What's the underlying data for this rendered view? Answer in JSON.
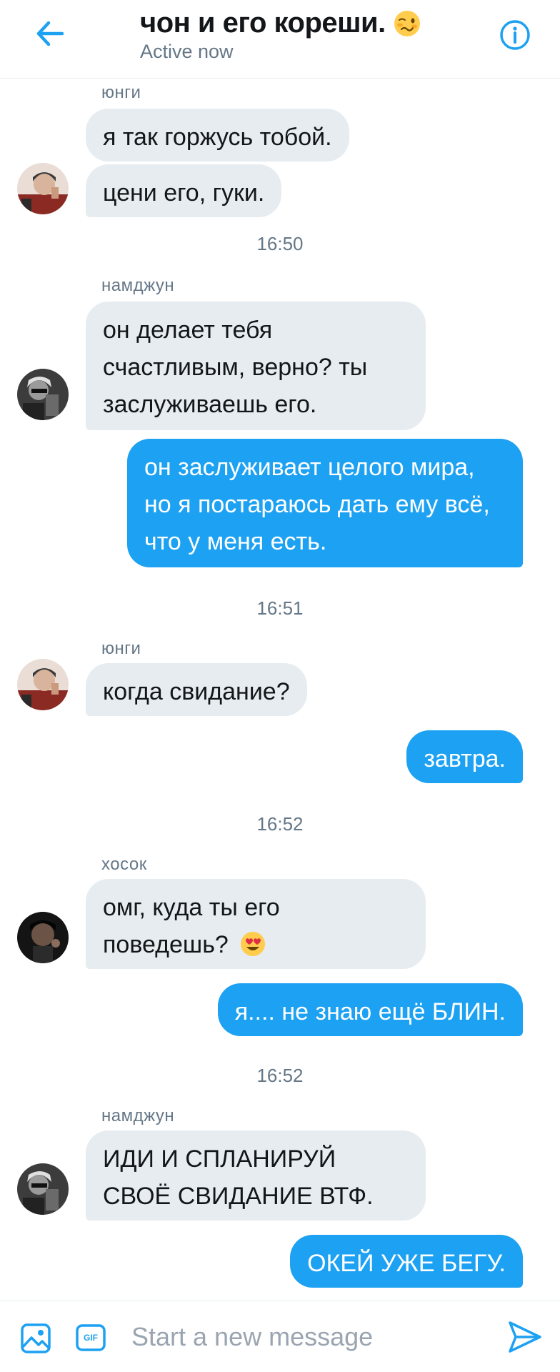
{
  "header": {
    "title": "чон и его кореши.",
    "title_emoji": "woozy-face-emoji",
    "subtitle": "Active now",
    "back_icon": "arrow-left-icon",
    "info_icon": "info-icon"
  },
  "colors": {
    "accent": "#1da1f2",
    "incoming_bubble": "#e6ecf0",
    "secondary_text": "#657786"
  },
  "messages": [
    {
      "sender": "юнги"
    },
    {
      "text": "я так горжусь тобой."
    },
    {
      "text": "цени его, гуки."
    },
    {
      "time": "16:50"
    },
    {
      "sender": "намджун"
    },
    {
      "text": "он делает тебя счастливым, верно? ты заслуживаешь его."
    },
    {
      "text": "он заслуживает целого мира, но я постараюсь дать ему всё, что у меня есть."
    },
    {
      "time": "16:51"
    },
    {
      "sender": "юнги"
    },
    {
      "text": "когда свидание?"
    },
    {
      "text": "завтра."
    },
    {
      "time": "16:52"
    },
    {
      "sender": "хосок"
    },
    {
      "text": "омг, куда ты его поведешь?",
      "emoji": "heart-eyes-emoji"
    },
    {
      "text": "я.... не знаю ещё БЛИН."
    },
    {
      "time": "16:52"
    },
    {
      "sender": "намджун"
    },
    {
      "text": "ИДИ И СПЛАНИРУЙ СВОЁ СВИДАНИЕ ВТФ."
    },
    {
      "text": "ОКЕЙ УЖЕ БЕГУ."
    }
  ],
  "composer": {
    "placeholder": "Start a new message",
    "gif_label": "GIF",
    "image_icon": "image-icon",
    "send_icon": "send-icon"
  }
}
